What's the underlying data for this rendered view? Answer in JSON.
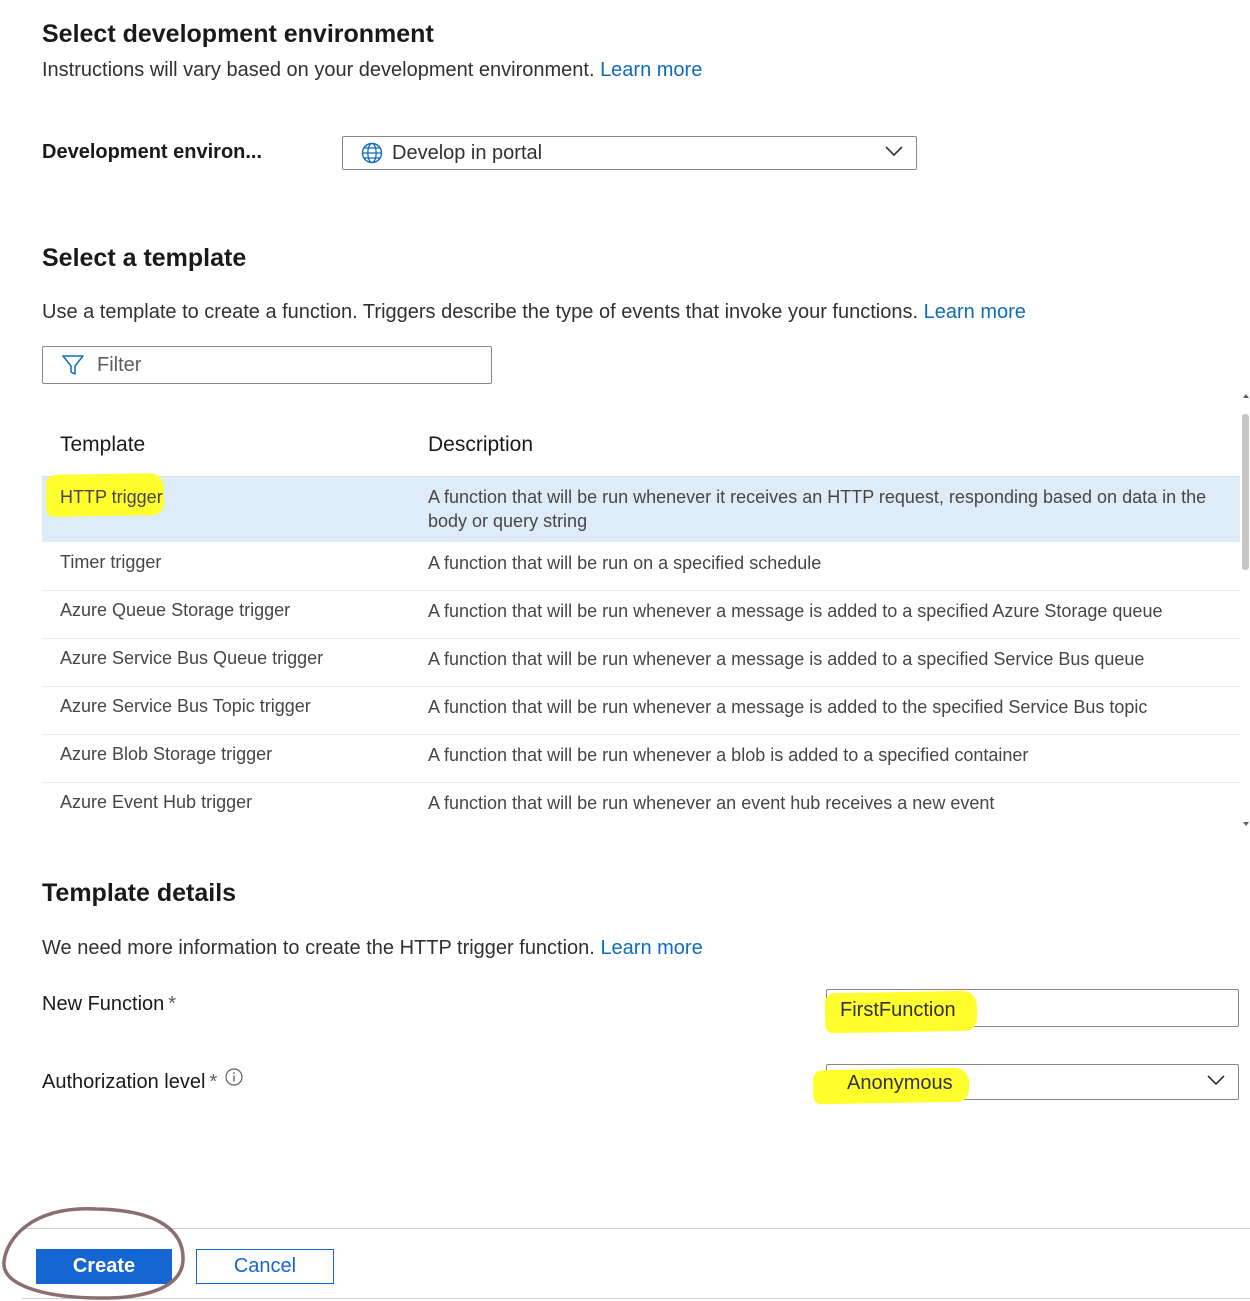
{
  "dev_env": {
    "heading": "Select development environment",
    "desc": "Instructions will vary based on your development environment.",
    "learn_more": "Learn more",
    "field_label": "Development environ...",
    "selected": "Develop in portal"
  },
  "template": {
    "heading": "Select a template",
    "desc": "Use a template to create a function. Triggers describe the type of events that invoke your functions.",
    "learn_more": "Learn more",
    "filter_placeholder": "Filter",
    "columns": {
      "template": "Template",
      "description": "Description"
    },
    "rows": [
      {
        "name": "HTTP trigger",
        "description": "A function that will be run whenever it receives an HTTP request, responding based on data in the body or query string"
      },
      {
        "name": "Timer trigger",
        "description": "A function that will be run on a specified schedule"
      },
      {
        "name": "Azure Queue Storage trigger",
        "description": "A function that will be run whenever a message is added to a specified Azure Storage queue"
      },
      {
        "name": "Azure Service Bus Queue trigger",
        "description": "A function that will be run whenever a message is added to a specified Service Bus queue"
      },
      {
        "name": "Azure Service Bus Topic trigger",
        "description": "A function that will be run whenever a message is added to the specified Service Bus topic"
      },
      {
        "name": "Azure Blob Storage trigger",
        "description": "A function that will be run whenever a blob is added to a specified container"
      },
      {
        "name": "Azure Event Hub trigger",
        "description": "A function that will be run whenever an event hub receives a new event"
      }
    ]
  },
  "details": {
    "heading": "Template details",
    "desc": "We need more information to create the HTTP trigger function.",
    "learn_more": "Learn more",
    "new_function_label": "New Function",
    "new_function_value": "FirstFunction",
    "auth_label": "Authorization level",
    "auth_value": "Anonymous",
    "required_mark": "*"
  },
  "footer": {
    "create": "Create",
    "cancel": "Cancel"
  },
  "colors": {
    "accent": "#1565d3",
    "link": "#0f6cbd",
    "selected_row": "#deecf9",
    "highlight": "#ffff2e",
    "annotation": "#8b6f6f"
  }
}
